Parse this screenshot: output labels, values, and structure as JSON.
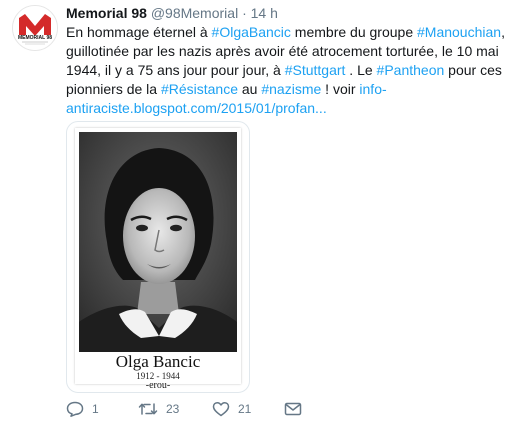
{
  "tweet": {
    "author_name": "Memorial 98",
    "author_handle": "@98Memorial",
    "separator": "·",
    "time": "14 h",
    "avatar": {
      "letter": "M",
      "label": "MEMORIAL 98",
      "brand_color": "#d42a2a"
    },
    "text_parts": [
      {
        "t": "En hommage éternel à ",
        "link": false
      },
      {
        "t": "#OlgaBancic",
        "link": true
      },
      {
        "t": " membre du groupe ",
        "link": false
      },
      {
        "t": "#Manouchian",
        "link": true
      },
      {
        "t": ", guillotinée par les nazis après avoir été atrocement torturée, le 10 mai 1944, il y a 75 ans jour pour jour, à ",
        "link": false
      },
      {
        "t": "#Stuttgart",
        "link": true
      },
      {
        "t": " . Le ",
        "link": false
      },
      {
        "t": "#Pantheon",
        "link": true
      },
      {
        "t": " pour ces pionniers de la ",
        "link": false
      },
      {
        "t": "#Résistance",
        "link": true
      },
      {
        "t": " au ",
        "link": false
      },
      {
        "t": "#nazisme",
        "link": true
      },
      {
        "t": " ! voir ",
        "link": false
      },
      {
        "t": "info-antiraciste.blogspot.com/2015/01/profan...",
        "link": true
      }
    ],
    "media": {
      "caption_name": "Olga Bancic",
      "caption_years": "1912 - 1944",
      "caption_sub": "-erou-"
    },
    "actions": {
      "reply_count": "1",
      "retweet_count": "23",
      "like_count": "21"
    },
    "colors": {
      "link": "#1da1f2",
      "muted": "#657786",
      "text": "#14171a"
    }
  }
}
